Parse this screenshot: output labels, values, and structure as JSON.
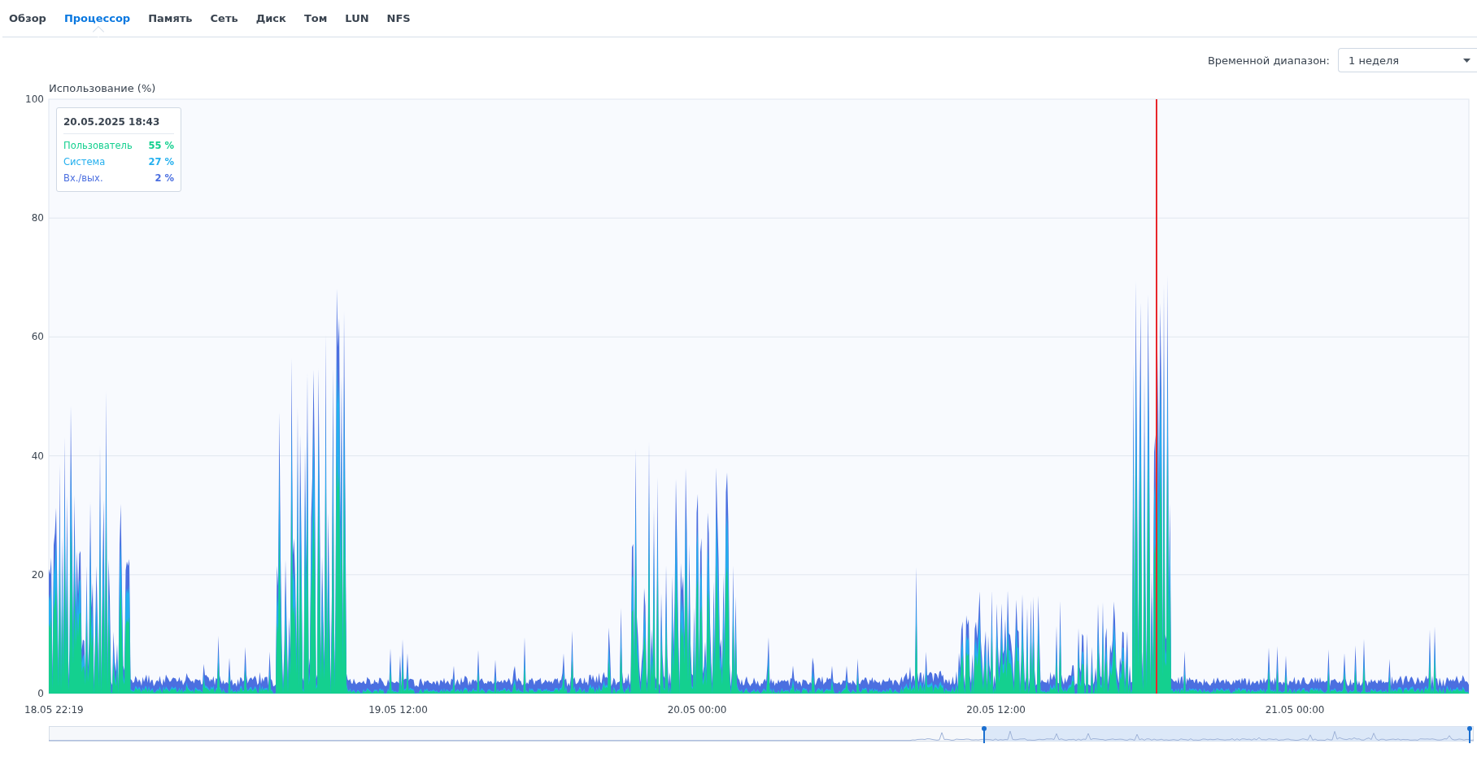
{
  "tabs": [
    {
      "label": "Обзор",
      "selected": false
    },
    {
      "label": "Процессор",
      "selected": true
    },
    {
      "label": "Память",
      "selected": false
    },
    {
      "label": "Сеть",
      "selected": false
    },
    {
      "label": "Диск",
      "selected": false
    },
    {
      "label": "Том",
      "selected": false
    },
    {
      "label": "LUN",
      "selected": false
    },
    {
      "label": "NFS",
      "selected": false
    }
  ],
  "time_range": {
    "label": "Временной диапазон:",
    "value": "1 неделя"
  },
  "chart": {
    "ylabel": "Использование (%)",
    "yticks": [
      "100",
      "80",
      "60",
      "40",
      "20",
      "0"
    ],
    "xlabels": [
      "18.05 22:19",
      "19.05 12:00",
      "20.05 00:00",
      "20.05 12:00",
      "21.05 00:00"
    ],
    "tooltip": {
      "title": "20.05.2025 18:43",
      "rows": [
        {
          "label": "Пользователь",
          "value": "55 %",
          "color": "#14d08f"
        },
        {
          "label": "Система",
          "value": "27 %",
          "color": "#25b0ee"
        },
        {
          "label": "Вх./вых.",
          "value": "2 %",
          "color": "#4b6fe0"
        }
      ]
    }
  }
}
